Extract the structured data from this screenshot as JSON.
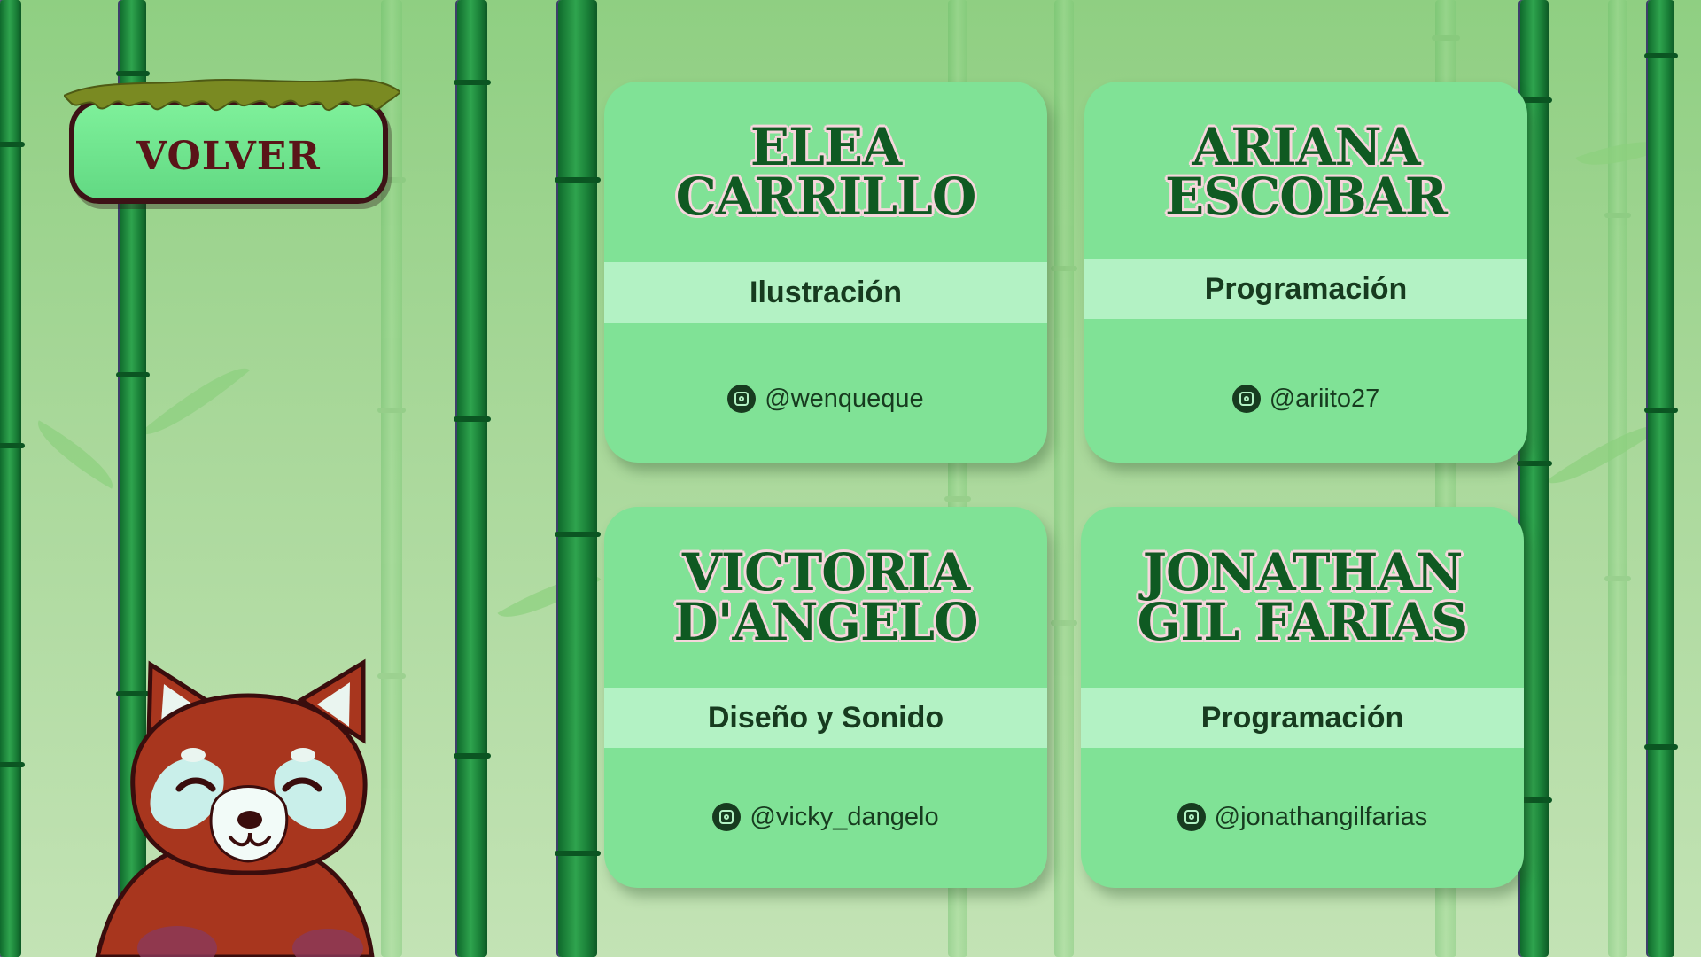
{
  "back_button": {
    "label": "VOLVER"
  },
  "team": [
    {
      "name_line1": "ELEA",
      "name_line2": "CARRILLO",
      "role": "Ilustración",
      "handle": "@wenqueque",
      "icon": "instagram-icon"
    },
    {
      "name_line1": "ARIANA",
      "name_line2": "ESCOBAR",
      "role": "Programación",
      "handle": "@ariito27",
      "icon": "instagram-icon"
    },
    {
      "name_line1": "VICTORIA",
      "name_line2": "D'ANGELO",
      "role": "Diseño y Sonido",
      "handle": "@vicky_dangelo",
      "icon": "instagram-icon"
    },
    {
      "name_line1": "JONATHAN",
      "name_line2": "GIL FARIAS",
      "role": "Programación",
      "handle": "@jonathangilfarias",
      "icon": "instagram-icon"
    }
  ],
  "colors": {
    "card": "#80e296",
    "role_band": "#b3f2c4",
    "name_text": "#0f5a22",
    "name_outline": "#f6d6dc",
    "button_border": "#3d1216",
    "button_text": "#5a1418"
  },
  "mascot": "red-panda"
}
